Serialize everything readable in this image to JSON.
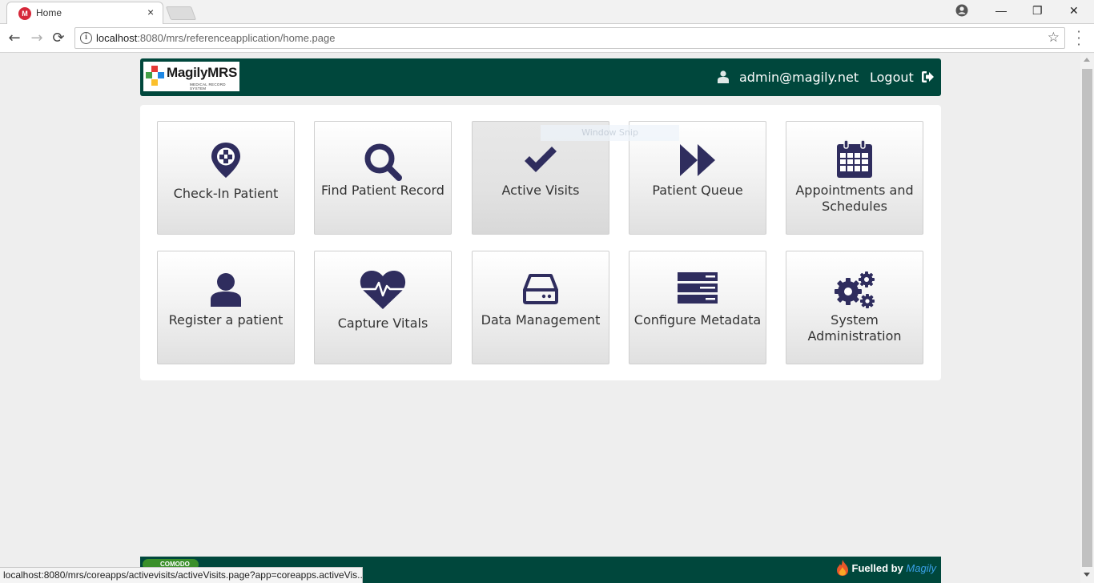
{
  "browser": {
    "tab_title": "Home",
    "tab_close": "×",
    "minimize": "—",
    "restore": "❐",
    "close": "✕",
    "back": "←",
    "forward": "→",
    "reload": "⟳",
    "url_host": "localhost",
    "url_rest": ":8080/mrs/referenceapplication/home.page",
    "bookmark": "☆",
    "status_url": "localhost:8080/mrs/coreapps/activevisits/activeVisits.page?app=coreapps.activeVis..."
  },
  "header": {
    "logo_text": "MagilyMRS",
    "logo_sub": "MEDICAL RECORD SYSTEM",
    "user_email": "admin@magily.net",
    "logout_label": "Logout"
  },
  "tiles": [
    {
      "label": "Check-In Patient",
      "icon": "map-pin-icon"
    },
    {
      "label": "Find Patient Record",
      "icon": "search-icon"
    },
    {
      "label": "Active Visits",
      "icon": "checkmark-icon"
    },
    {
      "label": "Patient Queue",
      "icon": "fast-forward-icon"
    },
    {
      "label": "Appointments and Schedules",
      "icon": "calendar-icon"
    },
    {
      "label": "Register a patient",
      "icon": "user-icon"
    },
    {
      "label": "Capture Vitals",
      "icon": "heartbeat-icon"
    },
    {
      "label": "Data Management",
      "icon": "hard-drive-icon"
    },
    {
      "label": "Configure Metadata",
      "icon": "server-icon"
    },
    {
      "label": "System Administration",
      "icon": "gears-icon"
    }
  ],
  "overlay": {
    "snip_label": "Window Snip"
  },
  "footer": {
    "badge_text": "COMODO",
    "fuelled_by": "Fuelled by",
    "brand": "Magily"
  },
  "colors": {
    "header_bg": "#00473c",
    "icon_color": "#2f2d5e",
    "page_bg": "#eeeeee"
  }
}
